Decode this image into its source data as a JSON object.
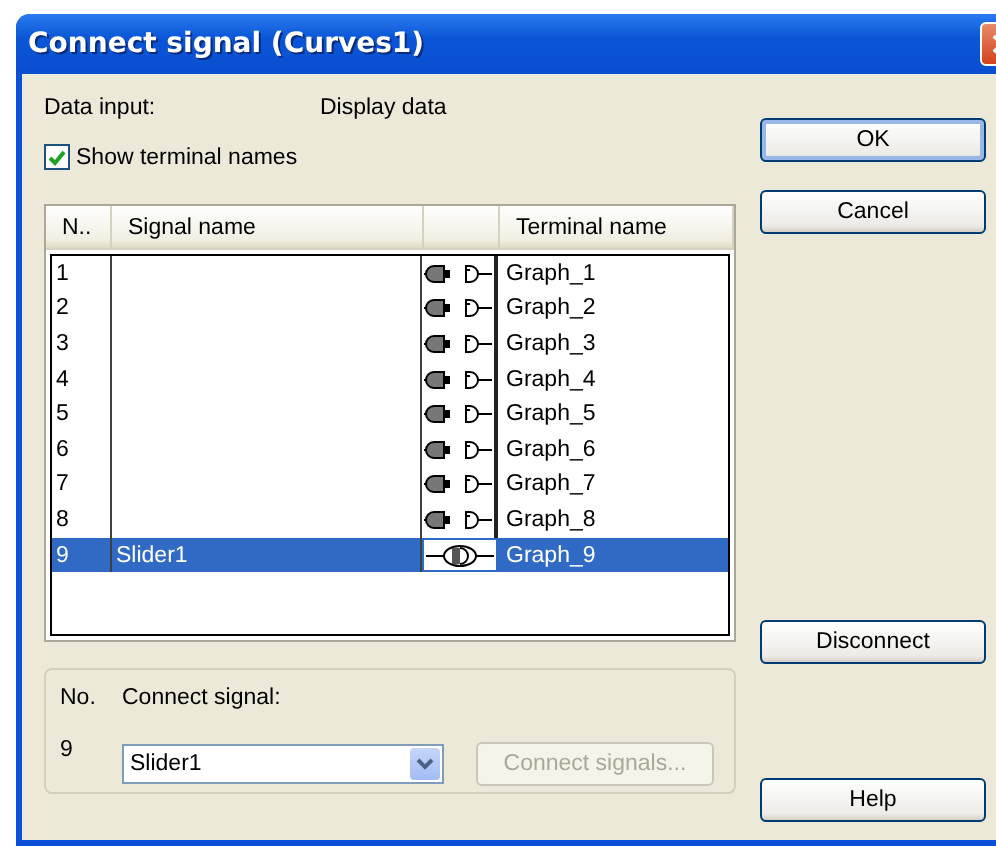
{
  "window": {
    "title": "Connect signal (Curves1)"
  },
  "data_input": {
    "label": "Data input:",
    "value": "Display data"
  },
  "show_terminal_names": {
    "label": "Show terminal names",
    "checked": true
  },
  "table": {
    "columns": [
      "N..",
      "Signal name",
      "Terminal name"
    ],
    "rows": [
      {
        "number": "1",
        "connected": false,
        "terminal": "Graph_1",
        "selected": false
      },
      {
        "number": "2",
        "connected": false,
        "terminal": "Graph_2",
        "selected": false
      },
      {
        "number": "3",
        "connected": false,
        "terminal": "Graph_3",
        "selected": false
      },
      {
        "number": "4",
        "connected": false,
        "terminal": "Graph_4",
        "selected": false
      },
      {
        "number": "5",
        "connected": false,
        "terminal": "Graph_5",
        "selected": false
      },
      {
        "number": "6",
        "connected": false,
        "terminal": "Graph_6",
        "selected": false
      },
      {
        "number": "7",
        "connected": false,
        "terminal": "Graph_7",
        "selected": false
      },
      {
        "number": "8",
        "connected": false,
        "terminal": "Graph_8",
        "selected": false
      },
      {
        "number": "9",
        "signal": "Slider1",
        "connected": true,
        "terminal": "Graph_9",
        "selected": true
      }
    ]
  },
  "connect": {
    "number_label": "No.",
    "signal_label": "Connect signal:",
    "number": "9",
    "signal_value": "Slider1",
    "button": {
      "label": "Connect signals...",
      "disabled": true
    }
  },
  "buttons": [
    {
      "label": "OK",
      "kind": "default"
    },
    {
      "label": "Cancel",
      "kind": "normal"
    },
    {
      "label": "Disconnect",
      "kind": "normal"
    },
    {
      "label": "Help",
      "kind": "normal"
    }
  ]
}
